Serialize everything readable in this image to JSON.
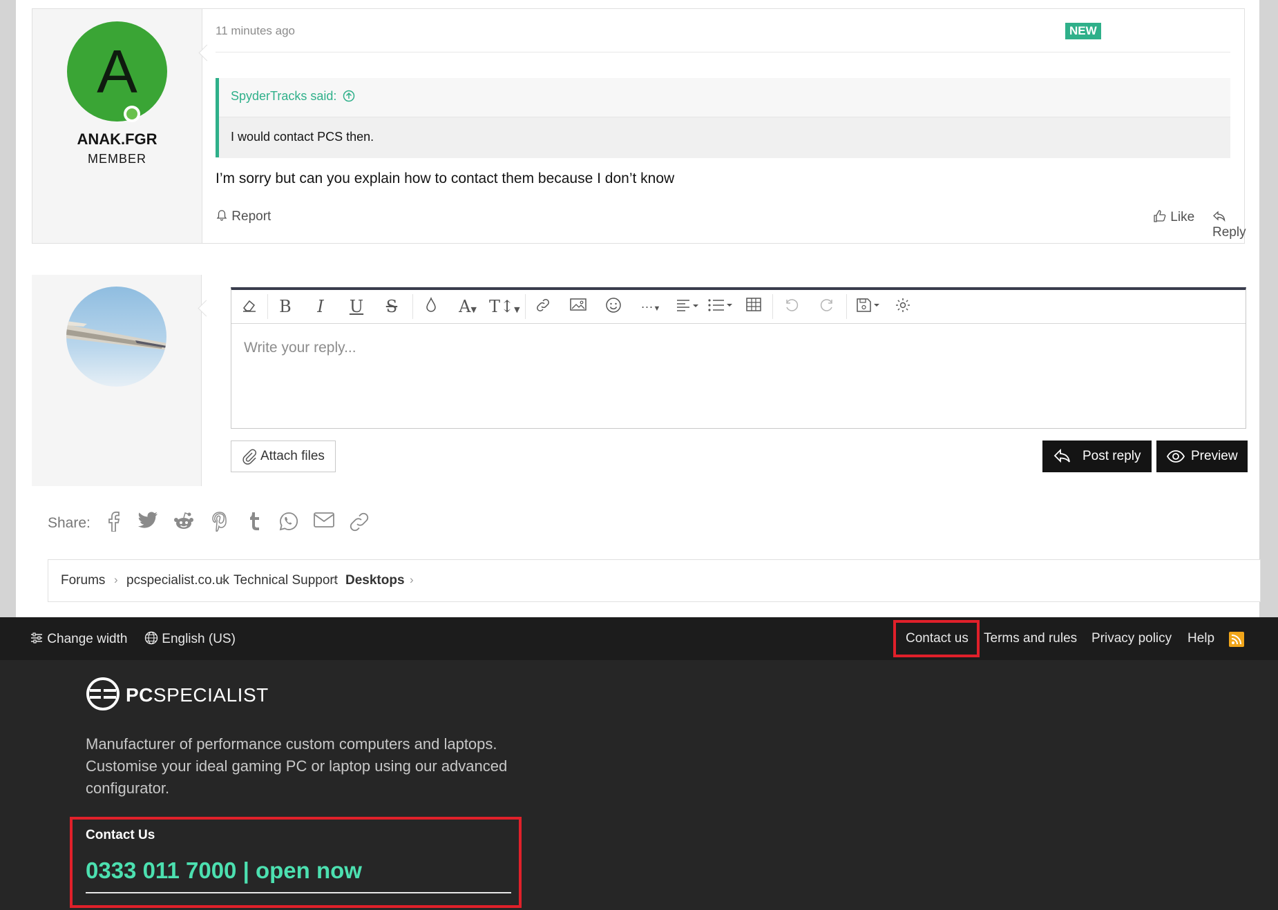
{
  "post": {
    "username": "ANAK.FGR",
    "avatar_letter": "A",
    "user_title": "MEMBER",
    "time": "11 minutes ago",
    "badge": "NEW",
    "quote_author": "SpyderTracks said:",
    "quote_text": "I would contact PCS then.",
    "message": "I’m sorry but can you explain how to contact them because I don’t know",
    "report_label": "Report",
    "like_label": "Like",
    "reply_label": "Reply"
  },
  "editor": {
    "placeholder": "Write your reply...",
    "attach_label": "Attach files",
    "post_reply_label": "Post reply",
    "preview_label": "Preview"
  },
  "share": {
    "label": "Share:",
    "icons": [
      "facebook-icon",
      "twitter-icon",
      "reddit-icon",
      "pinterest-icon",
      "tumblr-icon",
      "whatsapp-icon",
      "email-icon",
      "link-icon"
    ]
  },
  "breadcrumb": {
    "items": [
      "Forums",
      "pcspecialist.co.uk",
      "Technical Support",
      "Desktops"
    ]
  },
  "footer_bar": {
    "change_width": "Change width",
    "language": "English (US)",
    "contact_us": "Contact us",
    "terms": "Terms and rules",
    "privacy": "Privacy policy",
    "help": "Help"
  },
  "footer": {
    "logo_bold": "PC",
    "logo_rest": "SPECIALIST",
    "description": "Manufacturer of performance custom computers and laptops. Customise your ideal gaming PC or laptop using our advanced configurator.",
    "contact_heading": "Contact Us",
    "phone_text": "0333 011 7000 | open now"
  },
  "colors": {
    "accent": "#2fb08a",
    "avatar_bg": "#3aa535",
    "highlight": "#e0202a",
    "phone": "#4ce0b0",
    "rss": "#f0a51a"
  }
}
